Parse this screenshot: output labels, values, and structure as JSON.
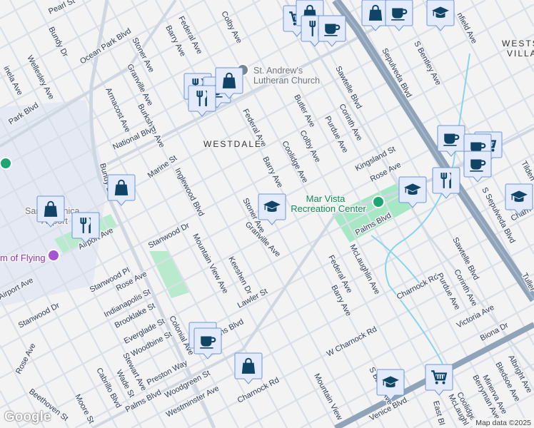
{
  "map": {
    "neighborhoods": [
      "WESTDALE",
      "WESTS",
      "VILLA"
    ],
    "pois": {
      "church": [
        "St. Andrew's",
        "Lutheran Church"
      ],
      "park": [
        "Mar Vista",
        "Recreation Center"
      ],
      "airport": [
        "Santa Monica",
        "Airport"
      ],
      "museum": "m of Flying"
    },
    "streets": [
      "Pearl St",
      "Bundy Dr",
      "Wellesley Ave",
      "inela Ave",
      "Ocean Park Blvd",
      "Park Blvd",
      "Armacost Ave",
      "Stoner Ave",
      "Granville Ave",
      "Burkshire Ave",
      "Barry Ave",
      "Federal Ave",
      "Colby Ave",
      "Federal Ave",
      "Barry Ave",
      "National Blvd",
      "Inglewood Blvd",
      "Marine St",
      "Butler Ave",
      "Purdue Ave",
      "Corinth Ave",
      "Colby Ave",
      "Coolidge Ave",
      "Sawtelle Blvd",
      "Sepulveda Blvd",
      "S Bentley Ave",
      "nfield Ave",
      "Kingsland St",
      "Rose Ave",
      "Palms Blvd",
      "McLaughlin Ave",
      "Federal Ave",
      "Barry Ave",
      "Charnock Rd",
      "W Charnock Rd",
      "Sawtelle Blvd",
      "Purdue Ave",
      "Corinth Ave",
      "Victoria Ave",
      "Biona Dr",
      "S Sepulveda Blvd",
      "Tilden",
      "Charn",
      "Tuller",
      "Albright Ave",
      "Bledsoe Ave",
      "Minerva Ave",
      "Berryman Ave",
      "Coolidge",
      "McLaughl",
      "East Bl",
      "Venice Blvd.",
      "S Barry Ave",
      "Mountain View",
      "Charnock Rd",
      "Westminster Ave",
      "Woodgreen St",
      "Palms Blvd",
      "Preston Way",
      "Stewart Ave",
      "Wade St",
      "Cabrillo Blvd",
      "Moore St",
      "Beethoven St",
      "Rose Ave",
      "Stanwood Dr",
      "Airport Ave",
      "Stanwood Pl",
      "Rose Ave",
      "Indianapolis St",
      "Brooklake St",
      "Everglade St",
      "Woodbine St",
      "Colonial Ave",
      "Mountain View Ave",
      "Keeshen Dr",
      "Lawler St",
      "Granville Ave",
      "Stanwood Dr",
      "Airport Ave",
      "ns Blvd",
      "Stoner Ave",
      "Bundy Dr"
    ],
    "marker_types": [
      "shopping-cart",
      "shopping-bag",
      "restaurant",
      "cafe",
      "school"
    ],
    "colors": {
      "marker_fill": "#e3ebfb",
      "marker_icon": "#0f4466",
      "water": "#88d4ee",
      "park": "#a6e8c4",
      "freeway": "#8fa3b9"
    }
  },
  "attribution": {
    "logo": "Google",
    "copyright": "Map data ©2025"
  }
}
